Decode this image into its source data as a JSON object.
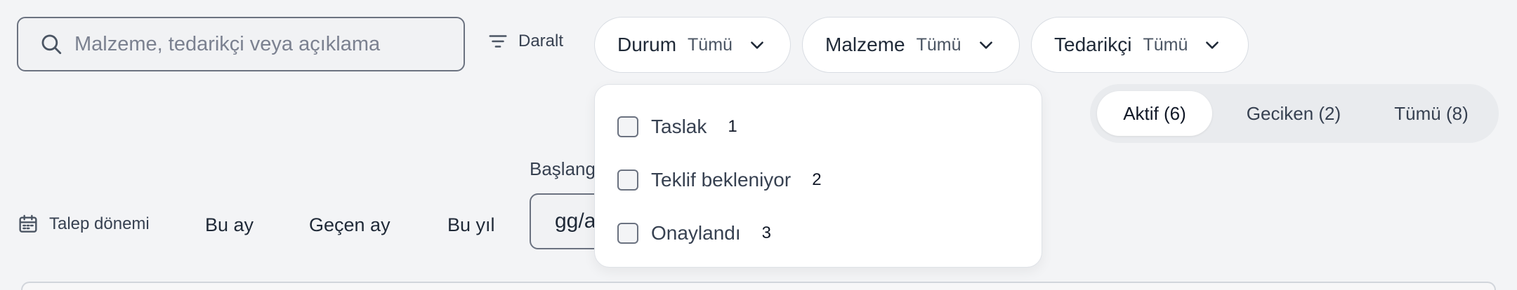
{
  "search": {
    "placeholder": "Malzeme, tedarikçi veya açıklama",
    "icon": "search-icon"
  },
  "collapse": {
    "label": "Daralt",
    "icon": "filter-lines-icon"
  },
  "filters": [
    {
      "label": "Durum",
      "value": "Tümü"
    },
    {
      "label": "Malzeme",
      "value": "Tümü"
    },
    {
      "label": "Tedarikçi",
      "value": "Tümü"
    }
  ],
  "status_dropdown": {
    "open": true,
    "options": [
      {
        "label": "Taslak",
        "count": "1",
        "checked": false
      },
      {
        "label": "Teklif bekleniyor",
        "count": "2",
        "checked": false
      },
      {
        "label": "Onaylandı",
        "count": "3",
        "checked": false
      }
    ]
  },
  "tabs": {
    "items": [
      "Aktif (6)",
      "Geciken (2)",
      "Tümü (8)"
    ],
    "active": "Aktif (6)"
  },
  "period": {
    "label": "Talep dönemi",
    "icon": "calendar-icon",
    "presets": [
      "Bu ay",
      "Geçen ay",
      "Bu yıl"
    ]
  },
  "start_date": {
    "label": "Başlangıç",
    "placeholder": "gg/aa/yyyy"
  }
}
